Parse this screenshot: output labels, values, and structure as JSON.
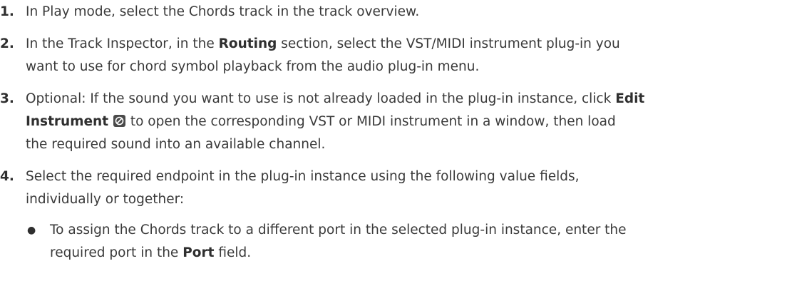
{
  "steps": [
    {
      "number": "1.",
      "text": "In Play mode, select the Chords track in the track overview."
    },
    {
      "number": "2.",
      "pre": "In the Track Inspector, in the ",
      "bold": "Routing",
      "post": " section, select the VST/MIDI instrument plug-in you",
      "line2": "want to use for chord symbol playback from the audio plug-in menu."
    },
    {
      "number": "3.",
      "pre": "Optional: If the sound you want to use is not already loaded in the plug-in instance, click ",
      "bold1": "Edit",
      "bold2": "Instrument",
      "icon": "edit-instrument-icon",
      "post": " to open the corresponding VST or MIDI instrument in a window, then load",
      "line3": "the required sound into an available channel."
    },
    {
      "number": "4.",
      "line1": "Select the required endpoint in the plug-in instance using the following value fields,",
      "line2": "individually or together:"
    }
  ],
  "bullets": [
    {
      "marker": "●",
      "line1": "To assign the Chords track to a different port in the selected plug-in instance, enter the",
      "pre": "required port in the ",
      "bold": "Port",
      "post": " field."
    }
  ]
}
